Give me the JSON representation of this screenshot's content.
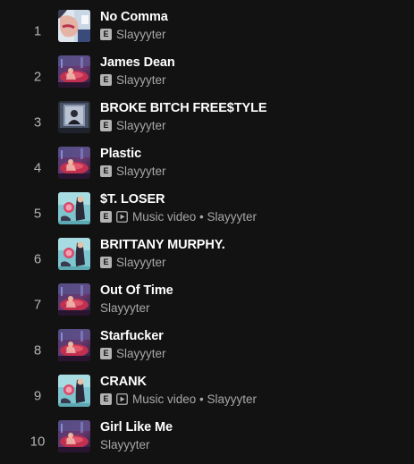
{
  "colors": {
    "background": "#121212",
    "title": "#ffffff",
    "subtitle": "#a7a7a7",
    "badge": "#b3b3b3"
  },
  "tracks": [
    {
      "number": "1",
      "title": "No Comma",
      "explicit_badge": "E",
      "subtitle": "Slayyyter",
      "cover": "cover-closeup"
    },
    {
      "number": "2",
      "title": "James Dean",
      "explicit_badge": "E",
      "subtitle": "Slayyyter",
      "cover": "cover-neon-car"
    },
    {
      "number": "3",
      "title": "BROKE BITCH FREE$TYLE",
      "explicit_badge": "E",
      "subtitle": "Slayyyter",
      "cover": "cover-mirror"
    },
    {
      "number": "4",
      "title": "Plastic",
      "explicit_badge": "E",
      "subtitle": "Slayyyter",
      "cover": "cover-neon-car"
    },
    {
      "number": "5",
      "title": "$T. LOSER",
      "explicit_badge": "E",
      "video_icon": "play-box-icon",
      "subtitle": "Music video • Slayyyter",
      "cover": "cover-teal-figure"
    },
    {
      "number": "6",
      "title": "BRITTANY MURPHY.",
      "explicit_badge": "E",
      "subtitle": "Slayyyter",
      "cover": "cover-teal-figure"
    },
    {
      "number": "7",
      "title": "Out Of Time",
      "explicit_badge": "",
      "subtitle": "Slayyyter",
      "cover": "cover-neon-car"
    },
    {
      "number": "8",
      "title": "Starfucker",
      "explicit_badge": "E",
      "subtitle": "Slayyyter",
      "cover": "cover-neon-car"
    },
    {
      "number": "9",
      "title": "CRANK",
      "explicit_badge": "E",
      "video_icon": "play-box-icon",
      "subtitle": "Music video • Slayyyter",
      "cover": "cover-teal-figure"
    },
    {
      "number": "10",
      "title": "Girl Like Me",
      "explicit_badge": "",
      "subtitle": "Slayyyter",
      "cover": "cover-neon-car"
    }
  ]
}
